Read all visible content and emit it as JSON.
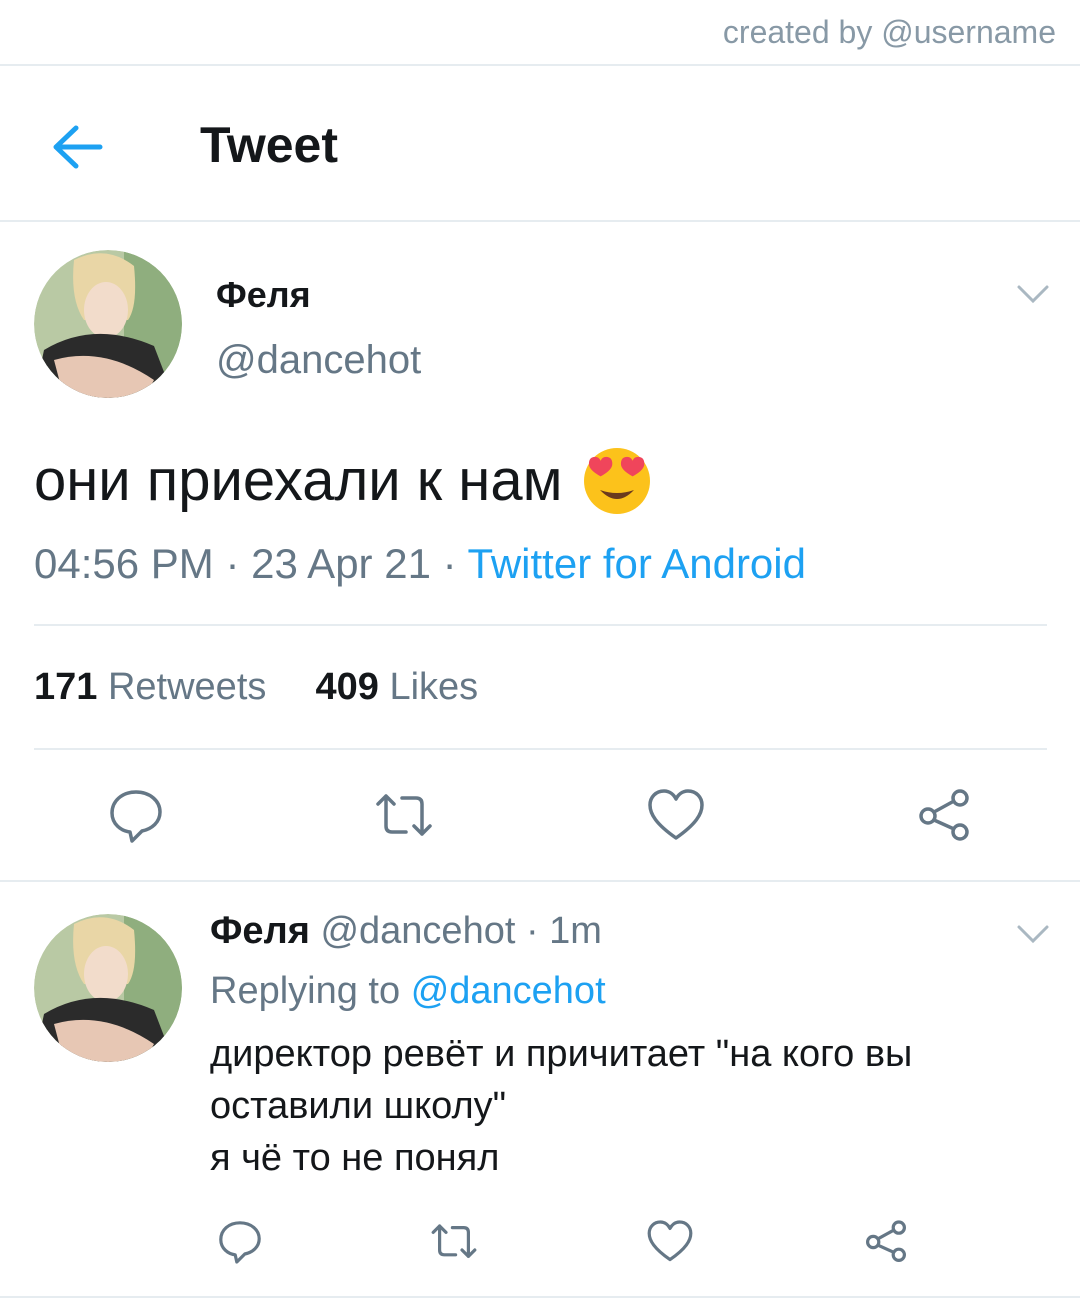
{
  "watermark": "created by @username",
  "header": {
    "title": "Tweet"
  },
  "tweet": {
    "author_name": "Феля",
    "author_handle": "@dancehot",
    "text": "они приехали к нам",
    "emoji": "smiling-face-with-heart-eyes",
    "time": "04:56 PM",
    "date": "23 Apr 21",
    "separator": " · ",
    "source": "Twitter for Android",
    "retweets_count": "171",
    "retweets_label": "Retweets",
    "likes_count": "409",
    "likes_label": "Likes"
  },
  "reply": {
    "author_name": "Феля",
    "author_handle": "@dancehot",
    "time": "1m",
    "replying_prefix": "Replying to",
    "replying_to": "@dancehot",
    "lines": [
      "директор ревёт и причитает \"на кого вы",
      "оставили школу\"",
      "я чё то не понял"
    ]
  },
  "colors": {
    "accent": "#1da1f2",
    "muted": "#657786",
    "divider": "#e6ecf0"
  }
}
